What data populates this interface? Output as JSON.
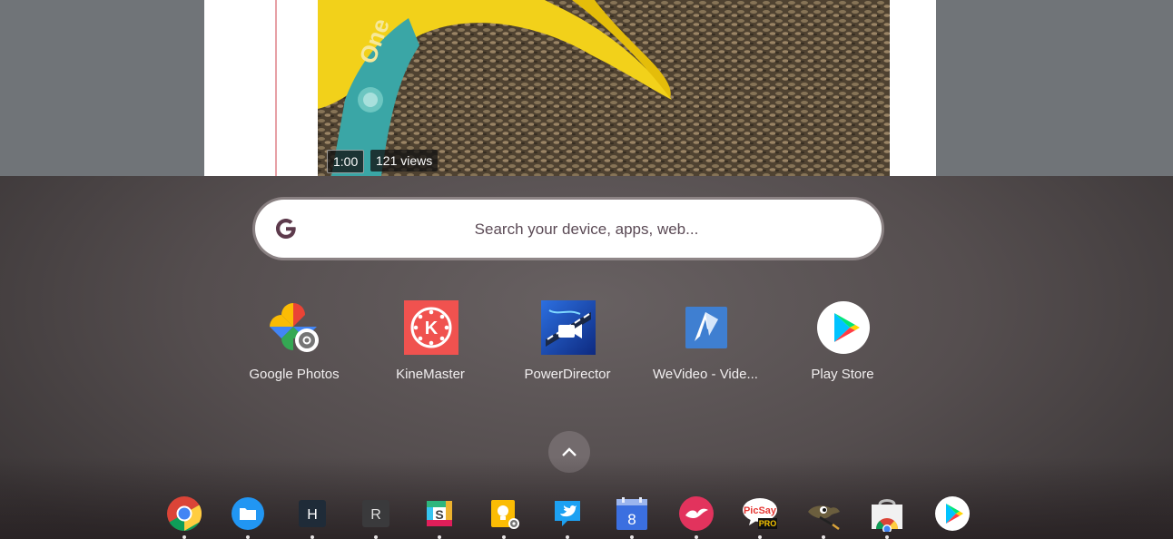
{
  "video": {
    "duration": "1:00",
    "views": "121 views"
  },
  "search": {
    "placeholder": "Search your device, apps, web..."
  },
  "apps": [
    {
      "label": "Google Photos",
      "icon": "google-photos-icon"
    },
    {
      "label": "KineMaster",
      "icon": "kinemaster-icon"
    },
    {
      "label": "PowerDirector",
      "icon": "powerdirector-icon"
    },
    {
      "label": "WeVideo - Vide...",
      "icon": "wevideo-icon"
    },
    {
      "label": "Play Store",
      "icon": "play-store-icon"
    }
  ],
  "shelf": {
    "items": [
      {
        "icon": "chrome-icon",
        "running": true
      },
      {
        "icon": "files-icon",
        "running": true
      },
      {
        "icon": "h-app-icon",
        "letter": "H",
        "running": true
      },
      {
        "icon": "r-app-icon",
        "letter": "R",
        "running": true
      },
      {
        "icon": "slack-icon",
        "running": true
      },
      {
        "icon": "keep-icon",
        "running": true
      },
      {
        "icon": "twitter-icon",
        "running": true
      },
      {
        "icon": "calendar-icon",
        "day": "8",
        "running": true
      },
      {
        "icon": "airmail-icon",
        "running": true
      },
      {
        "icon": "picsay-pro-icon",
        "brand": "PicSay",
        "badge": "PRO",
        "running": true
      },
      {
        "icon": "gimp-icon",
        "running": true
      },
      {
        "icon": "chrome-web-store-icon",
        "running": true
      },
      {
        "icon": "play-store-shelf-icon",
        "running": false
      }
    ]
  },
  "colors": {
    "kinemaster_red": "#f0524f",
    "powerdirector_blue": "#1a3fa6",
    "wevideo_blue": "#3f7fd1",
    "twitter_blue": "#1da1f2",
    "launcher_bg": "#5a5354"
  }
}
